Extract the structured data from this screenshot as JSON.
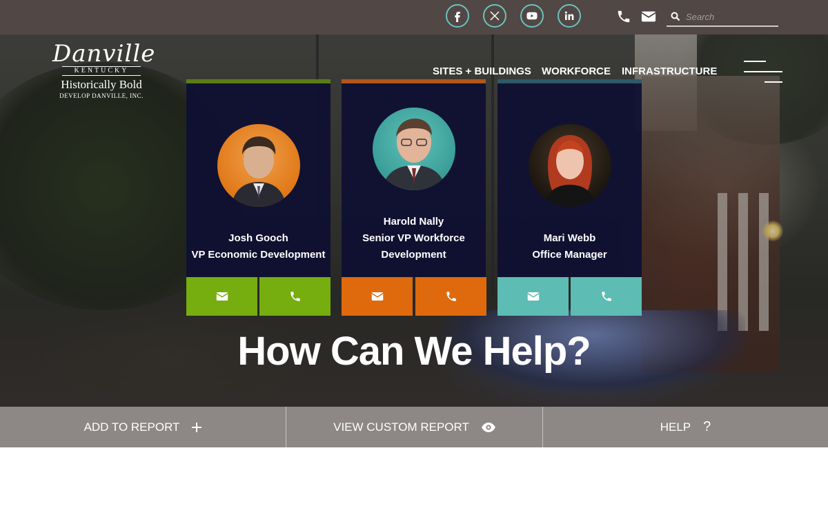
{
  "topbar": {
    "social": [
      {
        "name": "facebook-icon",
        "label": "f"
      },
      {
        "name": "x-twitter-icon",
        "label": "X"
      },
      {
        "name": "youtube-icon",
        "label": "▶"
      },
      {
        "name": "linkedin-icon",
        "label": "in"
      }
    ],
    "search_placeholder": "Search"
  },
  "logo": {
    "script": "Danville",
    "state": "KENTUCKY",
    "tagline": "Historically Bold",
    "org": "DEVELOP DANVILLE, INC."
  },
  "nav": {
    "items": [
      "SITES + BUILDINGS",
      "WORKFORCE",
      "INFRASTRUCTURE"
    ]
  },
  "staff": [
    {
      "name": "Josh Gooch",
      "title": "VP Economic Development",
      "accent": "#76ad0f"
    },
    {
      "name": "Harold Nally",
      "title_line1": "Senior VP Workforce",
      "title_line2": "Development",
      "accent": "#df6a0d"
    },
    {
      "name": "Mari Webb",
      "title": "Office Manager",
      "accent": "#5dbcb3"
    }
  ],
  "hero": {
    "headline": "How Can We Help?"
  },
  "actions": {
    "add_report": "ADD TO REPORT",
    "view_report": "VIEW CUSTOM REPORT",
    "help": "HELP",
    "help_icon": "?"
  },
  "colors": {
    "topbar": "#514745",
    "social_ring": "#6cc3bd",
    "card_bg": "#0f1032",
    "actionbar": "#8d8785"
  }
}
